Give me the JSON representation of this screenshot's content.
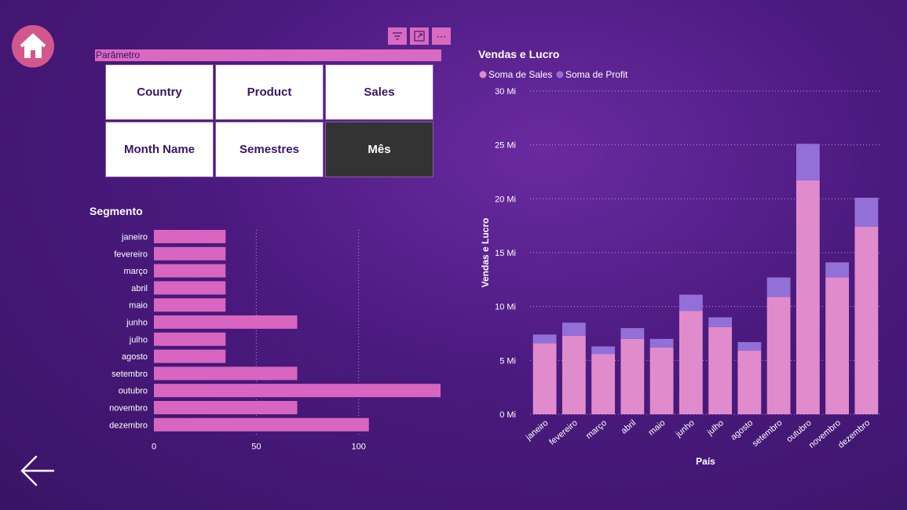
{
  "parameter": {
    "label": "Parâmetro",
    "options": [
      "Country",
      "Product",
      "Sales",
      "Month Name",
      "Semestres",
      "Mês"
    ],
    "selected": "Mês"
  },
  "toolbar": {
    "icons": [
      "filter-icon",
      "focus-mode-icon",
      "more-options-icon"
    ],
    "more_glyph": "⋯"
  },
  "colors": {
    "bar_segment": "#d866c0",
    "sales": "#e08ccc",
    "profit": "#9370d8",
    "home": "#d2578f"
  },
  "segment_title": "Segmento",
  "vendas_title": "Vendas e Lucro",
  "chart_data": [
    {
      "type": "bar",
      "orientation": "horizontal",
      "title": "Segmento",
      "categories": [
        "janeiro",
        "fevereiro",
        "março",
        "abril",
        "maio",
        "junho",
        "julho",
        "agosto",
        "setembro",
        "outubro",
        "novembro",
        "dezembro"
      ],
      "values": [
        35,
        35,
        35,
        35,
        35,
        70,
        35,
        35,
        70,
        140,
        70,
        105
      ],
      "xlim": [
        0,
        140
      ],
      "xticks": [
        "0",
        "50",
        "100"
      ],
      "grid": true
    },
    {
      "type": "bar",
      "stacked": true,
      "title": "Vendas e Lucro",
      "xlabel": "País",
      "ylabel": "Vendas e Lucro",
      "categories": [
        "janeiro",
        "fevereiro",
        "março",
        "abril",
        "maio",
        "junho",
        "julho",
        "agosto",
        "setembro",
        "outubro",
        "novembro",
        "dezembro"
      ],
      "series": [
        {
          "name": "Soma de  Sales",
          "values": [
            6.6,
            7.3,
            5.6,
            7.0,
            6.2,
            9.6,
            8.1,
            5.9,
            10.9,
            21.7,
            12.7,
            17.4
          ]
        },
        {
          "name": "Soma de Profit",
          "values": [
            0.8,
            1.2,
            0.7,
            1.0,
            0.8,
            1.5,
            0.9,
            0.8,
            1.8,
            3.4,
            1.4,
            2.7
          ]
        }
      ],
      "ylim": [
        0,
        30
      ],
      "yticks": [
        "0 Mi",
        "5 Mi",
        "10 Mi",
        "15 Mi",
        "20 Mi",
        "25 Mi",
        "30 Mi"
      ],
      "legend": "top-left",
      "grid": true
    }
  ]
}
